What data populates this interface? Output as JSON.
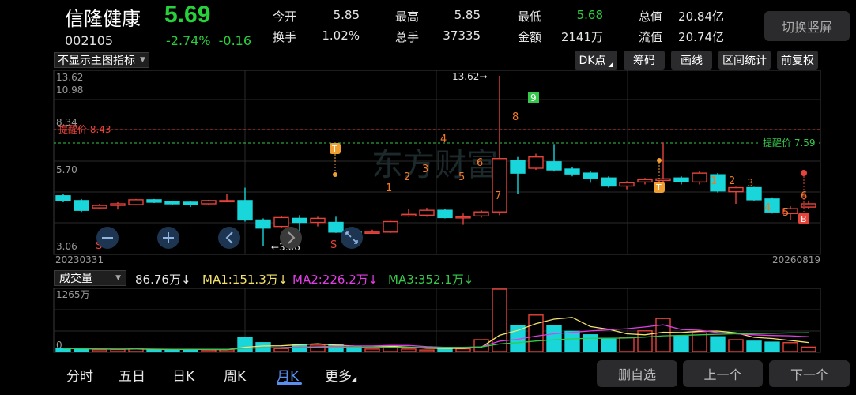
{
  "stock": {
    "name": "信隆健康",
    "price": "5.69",
    "code": "002105",
    "change_pct": "-2.74%",
    "change_amt": "-0.16"
  },
  "quote": {
    "open_label": "今开",
    "open": "5.85",
    "turnover_label": "换手",
    "turnover": "1.02%",
    "high_label": "最高",
    "high": "5.85",
    "volume_label": "总手",
    "volume": "37335",
    "low_label": "最低",
    "low": "5.68",
    "amount_label": "金额",
    "amount": "2141万",
    "mktcap_label": "总值",
    "mktcap": "20.84亿",
    "float_label": "流值",
    "float": "20.74亿"
  },
  "buttons": {
    "switch_portrait": "切换竖屏",
    "main_indicator": "不显示主图指标",
    "dk_point": "DK点",
    "chips": "筹码",
    "draw_line": "画线",
    "range_stats": "区间统计",
    "adjust": "前复权",
    "watchlist_remove": "删自选",
    "prev": "上一个",
    "next": "下一个"
  },
  "kline": {
    "axis_top": "13.62",
    "axis_2": "10.98",
    "axis_3": "8.34",
    "axis_4": "5.70",
    "axis_bottom": "3.06",
    "date_start": "20230331",
    "date_end": "20260819",
    "max_label": "13.62→",
    "min_label": "←3.06",
    "alert_red": "提醒价 8.43",
    "alert_green": "提醒价 7.59",
    "watermark": "东方财富"
  },
  "volume": {
    "indicator": "成交量",
    "current": "86.76万↓",
    "ma1": "MA1:151.3万↓",
    "ma2": "MA2:226.2万↓",
    "ma3": "MA3:352.1万↓",
    "axis_top": "1265万",
    "axis_zero": "0"
  },
  "tabs": [
    "分时",
    "五日",
    "日K",
    "周K",
    "月K",
    "更多"
  ],
  "colors": {
    "up": "#e8433b",
    "down": "#18d6d9",
    "green_text": "#27d13c",
    "ma1": "#f2e36b",
    "ma2": "#e23ee6",
    "ma3": "#35c94b",
    "active_tab": "#5a8ff0"
  },
  "chart_data": {
    "type": "candlestick",
    "ylim": [
      3.06,
      13.62
    ],
    "candles": [
      {
        "o": 6.2,
        "c": 5.9,
        "h": 6.3,
        "l": 5.8
      },
      {
        "o": 5.9,
        "c": 5.3,
        "h": 6.0,
        "l": 5.2
      },
      {
        "o": 5.45,
        "c": 5.6,
        "h": 5.7,
        "l": 5.4
      },
      {
        "o": 5.6,
        "c": 5.7,
        "h": 5.8,
        "l": 5.35
      },
      {
        "o": 5.65,
        "c": 5.95,
        "h": 6.0,
        "l": 5.6
      },
      {
        "o": 5.95,
        "c": 5.8,
        "h": 6.0,
        "l": 5.75
      },
      {
        "o": 5.85,
        "c": 5.7,
        "h": 5.9,
        "l": 5.65
      },
      {
        "o": 5.8,
        "c": 5.65,
        "h": 5.85,
        "l": 5.5
      },
      {
        "o": 5.7,
        "c": 5.9,
        "h": 5.95,
        "l": 5.65
      },
      {
        "o": 5.85,
        "c": 5.9,
        "h": 6.3,
        "l": 5.8
      },
      {
        "o": 5.9,
        "c": 4.7,
        "h": 6.7,
        "l": 4.6
      },
      {
        "o": 4.7,
        "c": 4.2,
        "h": 4.8,
        "l": 3.06
      },
      {
        "o": 4.3,
        "c": 4.85,
        "h": 4.95,
        "l": 4.2
      },
      {
        "o": 4.8,
        "c": 4.55,
        "h": 5.0,
        "l": 3.9
      },
      {
        "o": 4.55,
        "c": 4.8,
        "h": 4.9,
        "l": 4.3
      },
      {
        "o": 4.55,
        "c": 3.95,
        "h": 4.9,
        "l": 3.9
      },
      {
        "o": 3.95,
        "c": 3.9,
        "h": 4.05,
        "l": 3.5
      },
      {
        "o": 3.9,
        "c": 3.95,
        "h": 4.1,
        "l": 3.85
      },
      {
        "o": 3.95,
        "c": 4.6,
        "h": 4.65,
        "l": 3.9
      },
      {
        "o": 4.95,
        "c": 5.05,
        "h": 5.4,
        "l": 4.9
      },
      {
        "o": 5.0,
        "c": 5.3,
        "h": 5.45,
        "l": 4.9
      },
      {
        "o": 5.3,
        "c": 4.85,
        "h": 5.4,
        "l": 4.8
      },
      {
        "o": 4.85,
        "c": 4.9,
        "h": 5.1,
        "l": 4.4
      },
      {
        "o": 4.95,
        "c": 5.2,
        "h": 5.3,
        "l": 4.85
      },
      {
        "o": 5.2,
        "c": 8.5,
        "h": 13.62,
        "l": 5.0
      },
      {
        "o": 8.4,
        "c": 7.6,
        "h": 8.6,
        "l": 6.3
      },
      {
        "o": 7.9,
        "c": 8.6,
        "h": 8.8,
        "l": 7.8
      },
      {
        "o": 8.3,
        "c": 7.8,
        "h": 9.4,
        "l": 7.7
      },
      {
        "o": 7.85,
        "c": 7.55,
        "h": 8.0,
        "l": 7.4
      },
      {
        "o": 7.6,
        "c": 7.3,
        "h": 7.7,
        "l": 7.0
      },
      {
        "o": 7.3,
        "c": 6.8,
        "h": 7.4,
        "l": 6.7
      },
      {
        "o": 6.8,
        "c": 7.0,
        "h": 7.1,
        "l": 6.6
      },
      {
        "o": 7.05,
        "c": 7.2,
        "h": 7.3,
        "l": 6.9
      },
      {
        "o": 7.15,
        "c": 7.25,
        "h": 9.5,
        "l": 6.9
      },
      {
        "o": 7.3,
        "c": 7.1,
        "h": 7.4,
        "l": 6.9
      },
      {
        "o": 7.05,
        "c": 7.6,
        "h": 7.7,
        "l": 6.9
      },
      {
        "o": 7.5,
        "c": 6.5,
        "h": 7.6,
        "l": 6.4
      },
      {
        "o": 6.45,
        "c": 6.7,
        "h": 6.75,
        "l": 5.7
      },
      {
        "o": 6.7,
        "c": 5.95,
        "h": 6.75,
        "l": 5.9
      },
      {
        "o": 6.0,
        "c": 5.2,
        "h": 6.1,
        "l": 5.1
      },
      {
        "o": 5.1,
        "c": 5.4,
        "h": 5.55,
        "l": 4.7
      },
      {
        "o": 5.5,
        "c": 5.7,
        "h": 5.9,
        "l": 5.4
      }
    ],
    "volumes": [
      60,
      55,
      35,
      40,
      60,
      35,
      40,
      45,
      30,
      35,
      280,
      180,
      60,
      140,
      130,
      140,
      90,
      50,
      120,
      50,
      30,
      60,
      55,
      240,
      1265,
      520,
      740,
      520,
      410,
      340,
      250,
      280,
      420,
      670,
      310,
      380,
      300,
      240,
      210,
      190,
      180,
      90
    ],
    "vol_ylim": [
      0,
      1265
    ]
  }
}
